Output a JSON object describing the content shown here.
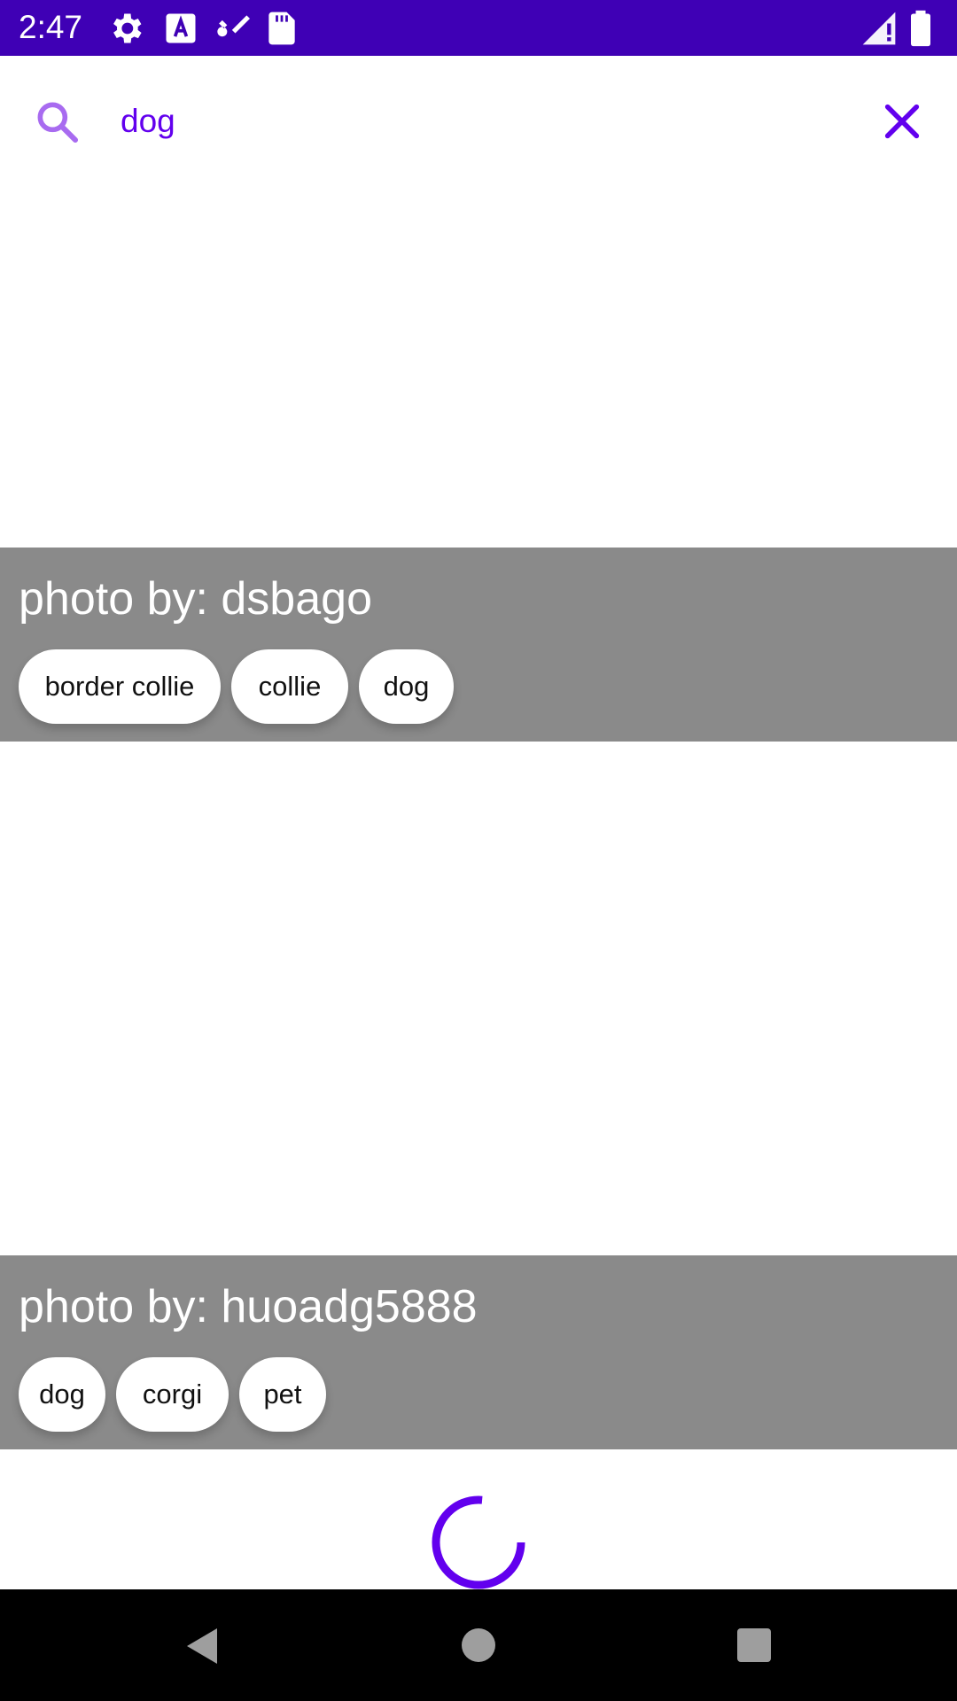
{
  "status_bar": {
    "time": "2:47"
  },
  "search": {
    "query": "dog"
  },
  "results": [
    {
      "caption": "photo by: dsbago",
      "tags": [
        "border collie",
        "collie",
        "dog"
      ]
    },
    {
      "caption": "photo by: huoadg5888",
      "tags": [
        "dog",
        "corgi",
        "pet"
      ]
    }
  ],
  "colors": {
    "status_bar": "#3f00b5",
    "accent": "#6200ee",
    "caption_bg": "#8a8a8a"
  }
}
